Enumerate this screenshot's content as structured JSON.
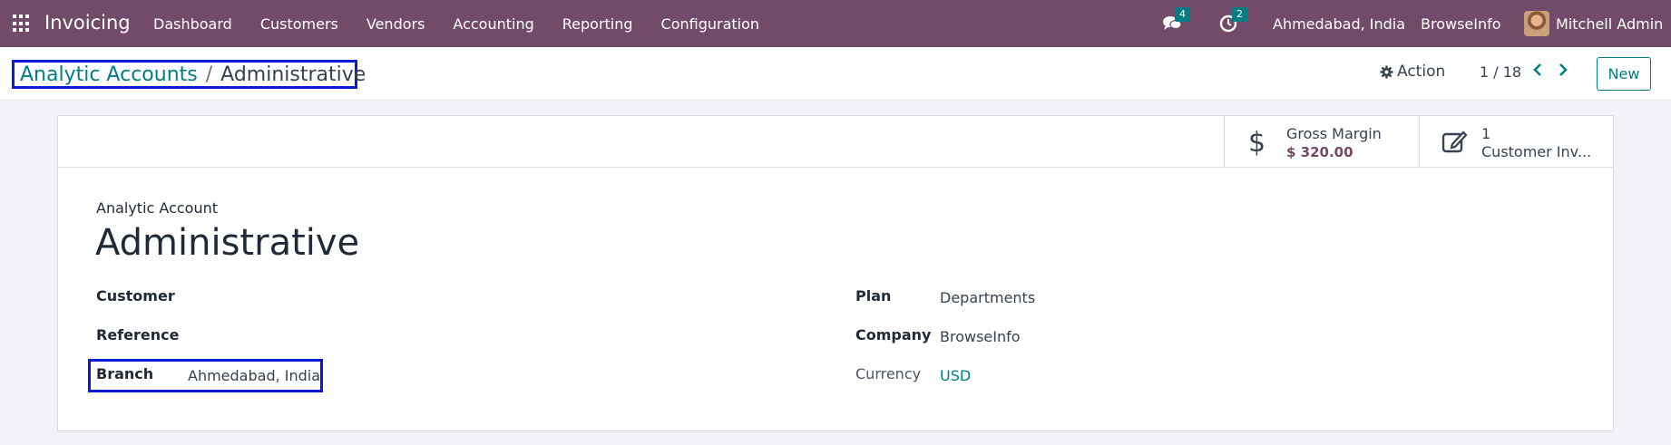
{
  "navbar": {
    "app_name": "Invoicing",
    "menu": [
      "Dashboard",
      "Customers",
      "Vendors",
      "Accounting",
      "Reporting",
      "Configuration"
    ],
    "messages_count": "4",
    "activities_count": "2",
    "branch": "Ahmedabad, India",
    "company": "BrowseInfo",
    "user": "Mitchell Admin",
    "colors": {
      "bar": "#714b67",
      "badge": "#017e84"
    }
  },
  "control": {
    "breadcrumb_parent": "Analytic Accounts",
    "breadcrumb_separator": "/",
    "breadcrumb_current": "Administrative",
    "action_label": "Action",
    "pager": "1 / 18",
    "new_label": "New"
  },
  "stat_buttons": {
    "gross_margin_label": "Gross Margin",
    "gross_margin_value": "$ 320.00",
    "invoices_count": "1",
    "invoices_label": "Customer Inv..."
  },
  "form": {
    "record_type_label": "Analytic Account",
    "name": "Administrative",
    "fields_left": {
      "customer_label": "Customer",
      "reference_label": "Reference",
      "branch_label": "Branch",
      "branch_value": "Ahmedabad, India"
    },
    "fields_right": {
      "plan_label": "Plan",
      "plan_value": "Departments",
      "company_label": "Company",
      "company_value": "BrowseInfo",
      "currency_label": "Currency",
      "currency_value": "USD"
    }
  }
}
